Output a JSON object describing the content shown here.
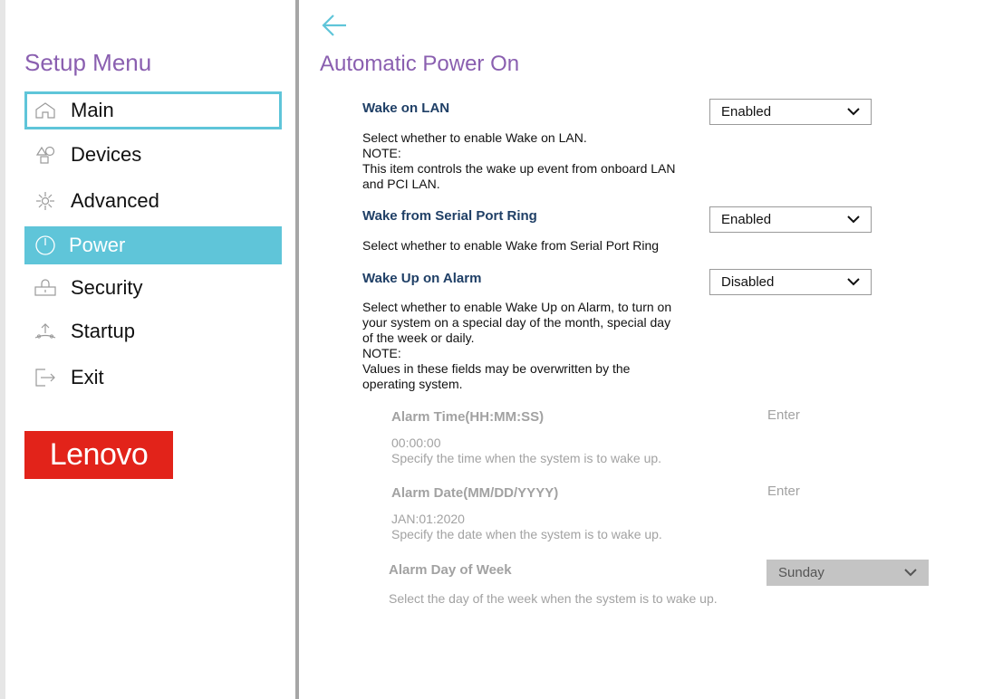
{
  "sidebar": {
    "title": "Setup Menu",
    "items": [
      {
        "label": "Main",
        "icon": "home-icon",
        "state": "focused"
      },
      {
        "label": "Devices",
        "icon": "devices-icon",
        "state": "normal"
      },
      {
        "label": "Advanced",
        "icon": "advanced-gear-icon",
        "state": "normal"
      },
      {
        "label": "Power",
        "icon": "power-icon",
        "state": "selected"
      },
      {
        "label": "Security",
        "icon": "security-icon",
        "state": "normal"
      },
      {
        "label": "Startup",
        "icon": "startup-icon",
        "state": "normal"
      },
      {
        "label": "Exit",
        "icon": "exit-icon",
        "state": "normal"
      }
    ],
    "logo_text": "Lenovo"
  },
  "main": {
    "back_icon": "back-arrow-icon",
    "title": "Automatic Power On",
    "wake_on_lan": {
      "name": "Wake on LAN",
      "value": "Enabled",
      "desc": [
        "Select whether to enable Wake on LAN.",
        "NOTE:",
        "This item controls the wake up event from onboard LAN",
        "and PCI LAN."
      ]
    },
    "wake_serial": {
      "name": "Wake from Serial Port Ring",
      "value": "Enabled",
      "desc": "Select whether to enable Wake from Serial Port Ring"
    },
    "wake_alarm": {
      "name": "Wake Up on Alarm",
      "value": "Disabled",
      "desc": [
        "Select whether to enable Wake Up on Alarm, to turn on",
        "your system on a special day of the month, special day",
        "of the week or daily.",
        "NOTE:",
        "Values in these fields may be overwritten by the",
        "operating system."
      ]
    },
    "alarm_time": {
      "name": "Alarm Time(HH:MM:SS)",
      "action": "Enter",
      "value": "00:00:00",
      "desc": "Specify the time when the system is to wake up."
    },
    "alarm_date": {
      "name": "Alarm Date(MM/DD/YYYY)",
      "action": "Enter",
      "value": "JAN:01:2020",
      "desc": "Specify the date when the system is to wake up."
    },
    "alarm_day": {
      "name": "Alarm Day of Week",
      "value": "Sunday",
      "desc": "Select the day of the week when the system is to wake up."
    }
  },
  "colors": {
    "accent_purple": "#8a5fb0",
    "accent_cyan": "#5fc5d9",
    "setting_blue": "#1f3f66",
    "disabled_gray": "#a2a2a2",
    "lenovo_red": "#e2231a"
  }
}
